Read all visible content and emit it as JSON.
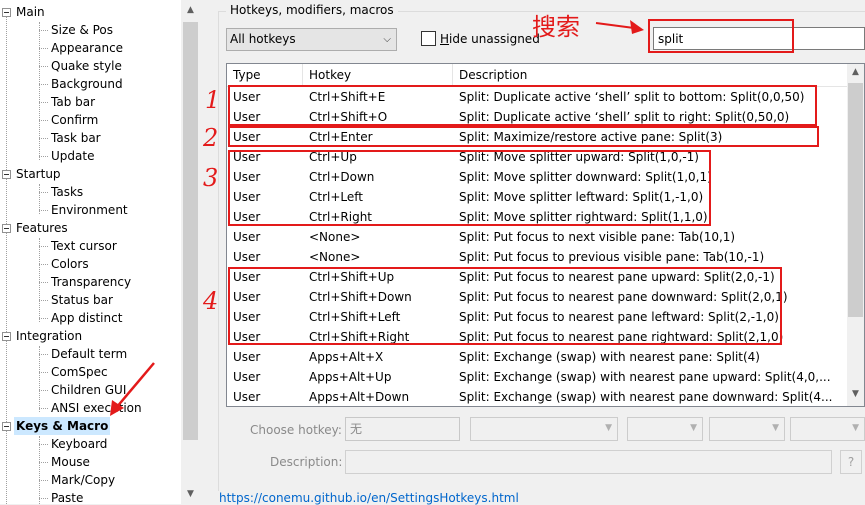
{
  "tree": {
    "items": [
      {
        "label": "Main",
        "level": 0,
        "expanded": true
      },
      {
        "label": "Size & Pos",
        "level": 1
      },
      {
        "label": "Appearance",
        "level": 1
      },
      {
        "label": "Quake style",
        "level": 1
      },
      {
        "label": "Background",
        "level": 1
      },
      {
        "label": "Tab bar",
        "level": 1
      },
      {
        "label": "Confirm",
        "level": 1
      },
      {
        "label": "Task bar",
        "level": 1
      },
      {
        "label": "Update",
        "level": 1
      },
      {
        "label": "Startup",
        "level": 0,
        "expanded": true
      },
      {
        "label": "Tasks",
        "level": 1
      },
      {
        "label": "Environment",
        "level": 1
      },
      {
        "label": "Features",
        "level": 0,
        "expanded": true
      },
      {
        "label": "Text cursor",
        "level": 1
      },
      {
        "label": "Colors",
        "level": 1
      },
      {
        "label": "Transparency",
        "level": 1
      },
      {
        "label": "Status bar",
        "level": 1
      },
      {
        "label": "App distinct",
        "level": 1
      },
      {
        "label": "Integration",
        "level": 0,
        "expanded": true
      },
      {
        "label": "Default term",
        "level": 1
      },
      {
        "label": "ComSpec",
        "level": 1
      },
      {
        "label": "Children GUI",
        "level": 1
      },
      {
        "label": "ANSI execution",
        "level": 1
      },
      {
        "label": "Keys & Macro",
        "level": 0,
        "expanded": true,
        "selected": true
      },
      {
        "label": "Keyboard",
        "level": 1
      },
      {
        "label": "Mouse",
        "level": 1
      },
      {
        "label": "Mark/Copy",
        "level": 1
      },
      {
        "label": "Paste",
        "level": 1
      }
    ]
  },
  "panel": {
    "group_title": "Hotkeys, modifiers, macros",
    "filter_value": "All hotkeys",
    "hide_unassigned_label": "Hide unassigned",
    "hide_unassigned_checked": false,
    "search_value": "split"
  },
  "annotations": {
    "search_label": "搜索",
    "group_marks": [
      "1",
      "2",
      "3",
      "4"
    ],
    "color": "#e31a1a"
  },
  "table": {
    "columns": [
      "Type",
      "Hotkey",
      "Description"
    ],
    "rows": [
      {
        "type": "User",
        "hotkey": "Ctrl+Shift+E",
        "desc": "Split: Duplicate active ‘shell’ split to bottom: Split(0,0,50)"
      },
      {
        "type": "User",
        "hotkey": "Ctrl+Shift+O",
        "desc": "Split: Duplicate active ‘shell’ split to right: Split(0,50,0)"
      },
      {
        "type": "User",
        "hotkey": "Ctrl+Enter",
        "desc": "Split: Maximize/restore active pane: Split(3)"
      },
      {
        "type": "User",
        "hotkey": "Ctrl+Up",
        "desc": "Split: Move splitter upward: Split(1,0,-1)"
      },
      {
        "type": "User",
        "hotkey": "Ctrl+Down",
        "desc": "Split: Move splitter downward: Split(1,0,1)"
      },
      {
        "type": "User",
        "hotkey": "Ctrl+Left",
        "desc": "Split: Move splitter leftward: Split(1,-1,0)"
      },
      {
        "type": "User",
        "hotkey": "Ctrl+Right",
        "desc": "Split: Move splitter rightward: Split(1,1,0)"
      },
      {
        "type": "User",
        "hotkey": "<None>",
        "desc": "Split: Put focus to next visible pane: Tab(10,1)"
      },
      {
        "type": "User",
        "hotkey": "<None>",
        "desc": "Split: Put focus to previous visible pane: Tab(10,-1)"
      },
      {
        "type": "User",
        "hotkey": "Ctrl+Shift+Up",
        "desc": "Split: Put focus to nearest pane upward: Split(2,0,-1)"
      },
      {
        "type": "User",
        "hotkey": "Ctrl+Shift+Down",
        "desc": "Split: Put focus to nearest pane downward: Split(2,0,1)"
      },
      {
        "type": "User",
        "hotkey": "Ctrl+Shift+Left",
        "desc": "Split: Put focus to nearest pane leftward: Split(2,-1,0)"
      },
      {
        "type": "User",
        "hotkey": "Ctrl+Shift+Right",
        "desc": "Split: Put focus to nearest pane rightward: Split(2,1,0)"
      },
      {
        "type": "User",
        "hotkey": "Apps+Alt+X",
        "desc": "Split: Exchange (swap) with nearest pane: Split(4)"
      },
      {
        "type": "User",
        "hotkey": "Apps+Alt+Up",
        "desc": "Split: Exchange (swap) with nearest pane upward: Split(4,0,..."
      },
      {
        "type": "User",
        "hotkey": "Apps+Alt+Down",
        "desc": "Split: Exchange (swap) with nearest pane downward: Split(4..."
      }
    ]
  },
  "bottom": {
    "choose_label": "Choose hotkey:",
    "choose_value": "无",
    "description_label": "Description:",
    "help_label": "?",
    "link": "https://conemu.github.io/en/SettingsHotkeys.html"
  }
}
